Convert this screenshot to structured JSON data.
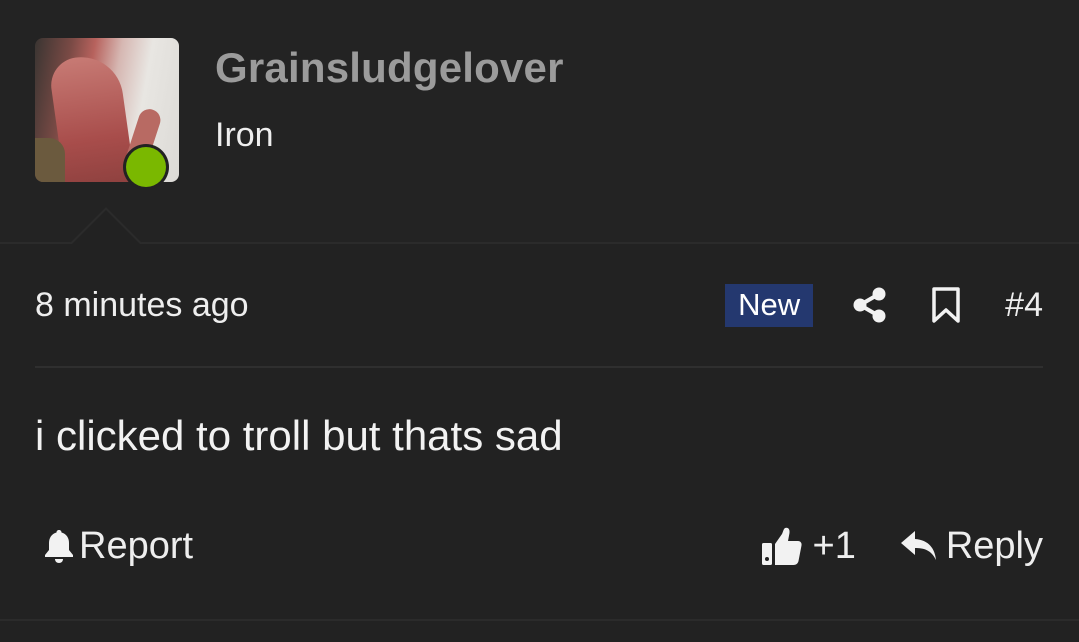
{
  "author": {
    "username": "Grainsludgelover",
    "rank": "Iron",
    "online_status_color": "#7ab800"
  },
  "meta": {
    "timestamp": "8 minutes ago",
    "badge": "New",
    "badge_color": "#24386f",
    "share_icon": "share-icon",
    "bookmark_icon": "bookmark-icon",
    "post_number": "#4"
  },
  "message": {
    "text": "i clicked to troll but thats sad"
  },
  "actions": {
    "report_icon": "bell-icon",
    "report_label": "Report",
    "like_icon": "thumbs-up-icon",
    "like_count": "+1",
    "reply_icon": "reply-icon",
    "reply_label": "Reply"
  }
}
